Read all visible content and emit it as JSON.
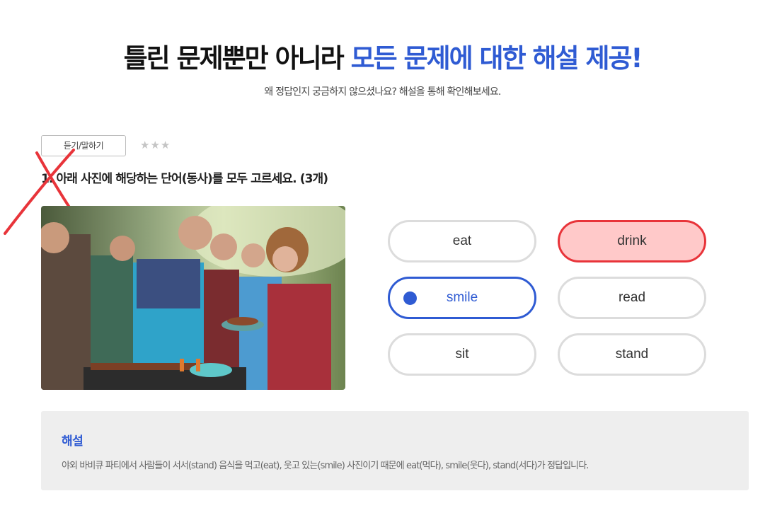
{
  "headline": {
    "dark_text": "틀린 문제뿐만 아니라 ",
    "accent_text": "모든 문제에 대한 해설 제공!",
    "subtitle": "왜 정답인지 궁금하지 않으셨나요? 해설을 통해 확인해보세요."
  },
  "question": {
    "category": "듣기/말하기",
    "difficulty": "★★★",
    "difficulty_level": 3,
    "text": "1. 아래 사진에 해당하는 단어(동사)를 모두 고르세요. (3개)",
    "result": "wrong",
    "image_icon": "barbecue-party-photo"
  },
  "choices": [
    {
      "label": "eat",
      "state": "default"
    },
    {
      "label": "drink",
      "state": "wrong"
    },
    {
      "label": "smile",
      "state": "selected"
    },
    {
      "label": "read",
      "state": "default"
    },
    {
      "label": "sit",
      "state": "default"
    },
    {
      "label": "stand",
      "state": "default"
    }
  ],
  "explanation": {
    "title": "해설",
    "text": "야외 바비큐 파티에서 사람들이 서서(stand) 음식을 먹고(eat), 웃고 있는(smile) 사진이기 때문에 eat(먹다), smile(웃다), stand(서다)가 정답입니다."
  },
  "colors": {
    "accent": "#2f5bd3",
    "wrong_fill": "#ffc9c9",
    "wrong_border": "#e8343a",
    "wrong_mark": "#e8343a"
  }
}
